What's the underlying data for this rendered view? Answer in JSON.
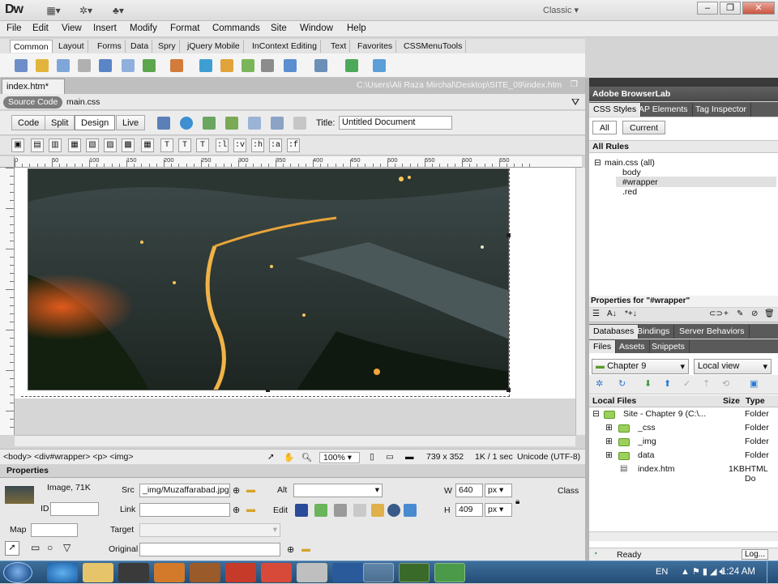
{
  "app": {
    "logo": "Dw",
    "workspace": "Classic",
    "window_controls": [
      "minimize",
      "restore",
      "close"
    ]
  },
  "menu": [
    "File",
    "Edit",
    "View",
    "Insert",
    "Modify",
    "Format",
    "Commands",
    "Site",
    "Window",
    "Help"
  ],
  "insert_tabs": [
    "Common",
    "Layout",
    "Forms",
    "Data",
    "Spry",
    "jQuery Mobile",
    "InContext Editing",
    "Text",
    "Favorites",
    "CSSMenuTools"
  ],
  "active_insert_tab": "Common",
  "document": {
    "tab": "index.htm*",
    "path": "C:\\Users\\Ali Raza Mirchal\\Desktop\\SITE_09\\index.htm",
    "source_code": "Source Code",
    "related_file": "main.css",
    "views": [
      "Code",
      "Split",
      "Design",
      "Live"
    ],
    "active_view": "Design",
    "title_label": "Title:",
    "title_value": "Untitled Document"
  },
  "css_toolbar": [
    ":l",
    ":v",
    ":h",
    ":a",
    ":f"
  ],
  "ruler_marks": [
    "0",
    "50",
    "100",
    "150",
    "200",
    "250",
    "300",
    "350",
    "400",
    "450",
    "500",
    "550",
    "600",
    "650"
  ],
  "status": {
    "tag_selector": "<body> <div#wrapper> <p> <img>",
    "zoom": "100%",
    "dimensions": "739 x 352",
    "download": "1K / 1 sec",
    "encoding": "Unicode (UTF-8)"
  },
  "properties": {
    "header": "Properties",
    "image_info": "Image, 71K",
    "id_label": "ID",
    "src_label": "Src",
    "src_value": "_img/Muzaffarabad.jpg",
    "link_label": "Link",
    "alt_label": "Alt",
    "edit_label": "Edit",
    "w_label": "W",
    "w_value": "640",
    "w_unit": "px",
    "h_label": "H",
    "h_value": "409",
    "h_unit": "px",
    "class_label": "Class",
    "map_label": "Map",
    "target_label": "Target",
    "original_label": "Original"
  },
  "panels": {
    "browserlab": "Adobe BrowserLab",
    "css_tabs": [
      "CSS Styles",
      "AP Elements",
      "Tag Inspector"
    ],
    "modes": [
      "All",
      "Current"
    ],
    "all_rules": "All Rules",
    "rules": {
      "root": "main.css (all)",
      "children": [
        "body",
        "#wrapper",
        ".red"
      ],
      "selected": "#wrapper"
    },
    "properties_for": "Properties for \"#wrapper\"",
    "db_tabs": [
      "Databases",
      "Bindings",
      "Server Behaviors"
    ],
    "files_tabs": [
      "Files",
      "Assets",
      "Snippets"
    ],
    "site_select": "Chapter 9",
    "view_select": "Local view",
    "file_headers": {
      "name": "Local Files",
      "size": "Size",
      "type": "Type"
    },
    "files": [
      {
        "name": "Site - Chapter 9 (C:\\...",
        "size": "",
        "type": "Folder"
      },
      {
        "name": "_css",
        "size": "",
        "type": "Folder"
      },
      {
        "name": "_img",
        "size": "",
        "type": "Folder"
      },
      {
        "name": "data",
        "size": "",
        "type": "Folder"
      },
      {
        "name": "index.htm",
        "size": "1KB",
        "type": "HTML Do"
      }
    ],
    "ready": "Ready",
    "log_button": "Log..."
  },
  "taskbar": {
    "language": "EN",
    "time": "1:24 AM"
  },
  "colors": {
    "panel_dark": "#555555",
    "folder_green": "#9cd05a",
    "taskbar_blue": "#2f5d8a"
  }
}
